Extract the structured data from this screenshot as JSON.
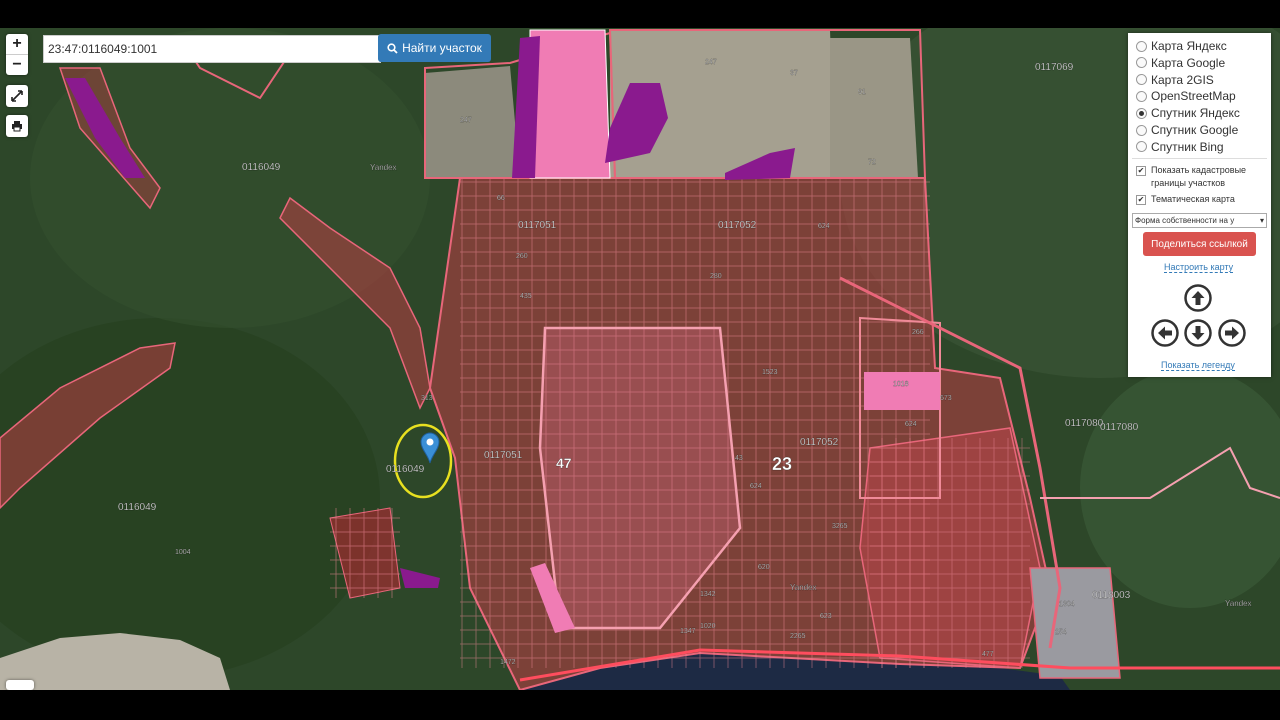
{
  "search": {
    "value": "23:47:0116049:1001",
    "button_label": "Найти участок"
  },
  "zoom": {
    "in_label": "+",
    "out_label": "−"
  },
  "layers": [
    {
      "label": "Карта Яндекс",
      "selected": false
    },
    {
      "label": "Карта Google",
      "selected": false
    },
    {
      "label": "Карта 2GIS",
      "selected": false
    },
    {
      "label": "OpenStreetMap",
      "selected": false
    },
    {
      "label": "Спутник Яндекс",
      "selected": true
    },
    {
      "label": "Спутник Google",
      "selected": false
    },
    {
      "label": "Спутник Bing",
      "selected": false
    }
  ],
  "options": {
    "show_borders_label": "Показать кадастровые границы участков",
    "thematic_label": "Тематическая карта",
    "ownership_select": "Форма собственности на у",
    "share_button": "Поделиться ссылкой",
    "configure_link": "Настроить карту",
    "legend_link": "Показать легенду"
  },
  "map_labels": {
    "quarters": [
      "0117069",
      "0116049",
      "0116049",
      "0117051",
      "0117052",
      "0117052",
      "0117051",
      "0116049",
      "0117080",
      "0117080",
      "0118003"
    ],
    "district": "23",
    "sub_district": "47",
    "watermarks": [
      "Yandex",
      "Yandex",
      "Yandex"
    ],
    "plots": [
      "247",
      "37",
      "91",
      "247",
      "72",
      "66",
      "260",
      "435",
      "624",
      "280",
      "1523",
      "1018",
      "624",
      "266",
      "673",
      "1004",
      "313",
      "624",
      "43",
      "3265",
      "620",
      "1342",
      "1347",
      "2265",
      "623",
      "477",
      "254",
      "1472",
      "1020",
      "1304"
    ]
  },
  "colors": {
    "parcel_stroke": "#e8667a",
    "parcel_fill": "rgba(224,60,80,0.45)",
    "municipal_pink": "#f07cb4",
    "ownership_purple": "#8a1a8e",
    "marker_blue": "#3a8fd6",
    "highlight_yellow": "#e8e020",
    "sea": "#1d2a44"
  }
}
